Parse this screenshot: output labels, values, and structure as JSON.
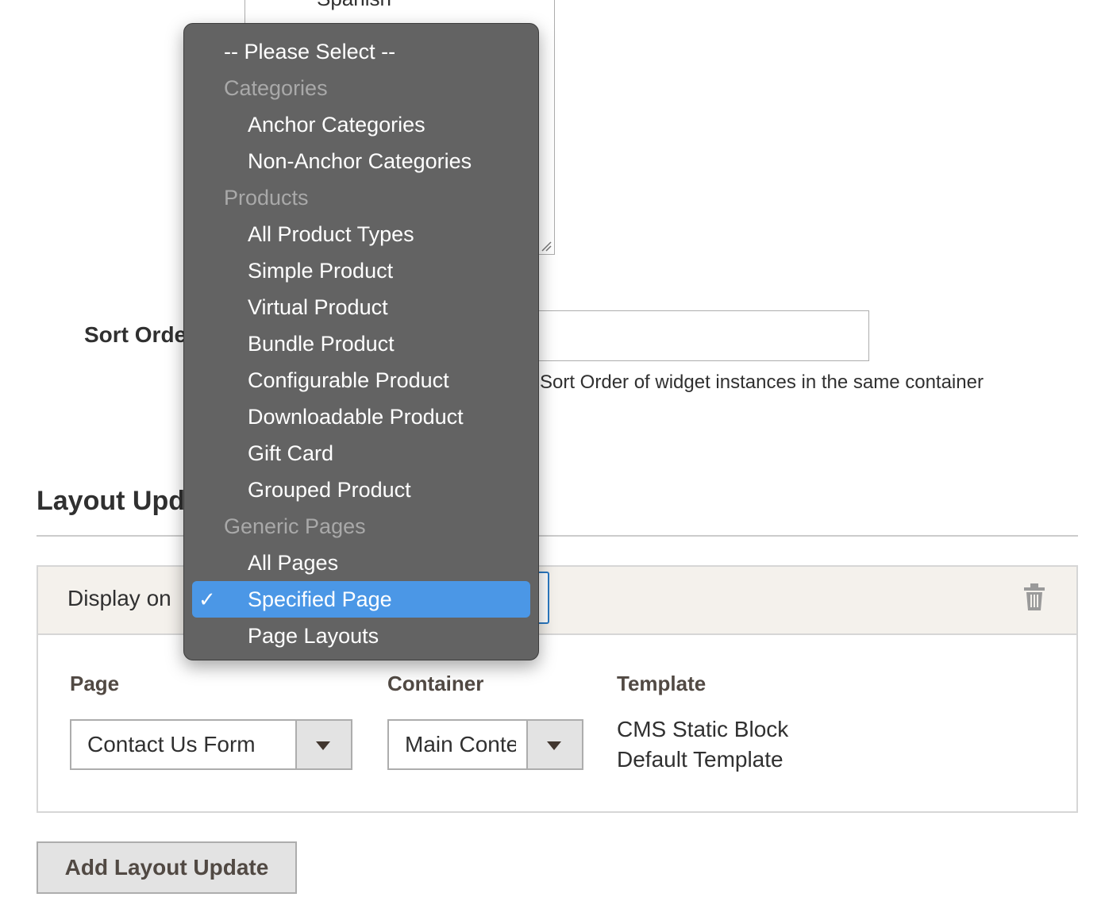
{
  "store_views": {
    "visible_option": "Spanish"
  },
  "sort_order": {
    "label": "Sort Order",
    "value": "",
    "note": "Sort Order of widget instances in the same container"
  },
  "layout_updates": {
    "title": "Layout Updates",
    "display_on_label": "Display on",
    "display_on_value": "Specified Page",
    "columns": {
      "page_label": "Page",
      "container_label": "Container",
      "template_label": "Template"
    },
    "page_value": "Contact Us Form",
    "container_value": "Main Content Area",
    "template_value_line1": "CMS Static Block",
    "template_value_line2": "Default Template",
    "add_button": "Add Layout Update"
  },
  "dropdown": {
    "items": [
      {
        "label": "-- Please Select --",
        "kind": "top"
      },
      {
        "label": "Categories",
        "kind": "group"
      },
      {
        "label": "Anchor Categories",
        "kind": "child"
      },
      {
        "label": "Non-Anchor Categories",
        "kind": "child"
      },
      {
        "label": "Products",
        "kind": "group"
      },
      {
        "label": "All Product Types",
        "kind": "child"
      },
      {
        "label": "Simple Product",
        "kind": "child"
      },
      {
        "label": "Virtual Product",
        "kind": "child"
      },
      {
        "label": "Bundle Product",
        "kind": "child"
      },
      {
        "label": "Configurable Product",
        "kind": "child"
      },
      {
        "label": "Downloadable Product",
        "kind": "child"
      },
      {
        "label": "Gift Card",
        "kind": "child"
      },
      {
        "label": "Grouped Product",
        "kind": "child"
      },
      {
        "label": "Generic Pages",
        "kind": "group"
      },
      {
        "label": "All Pages",
        "kind": "child"
      },
      {
        "label": "Specified Page",
        "kind": "child",
        "selected": true
      },
      {
        "label": "Page Layouts",
        "kind": "child"
      }
    ],
    "checkmark": "✓"
  },
  "colors": {
    "selection": "#4b97e6",
    "menu_bg": "#636363",
    "focus_border": "#2b79c2"
  }
}
